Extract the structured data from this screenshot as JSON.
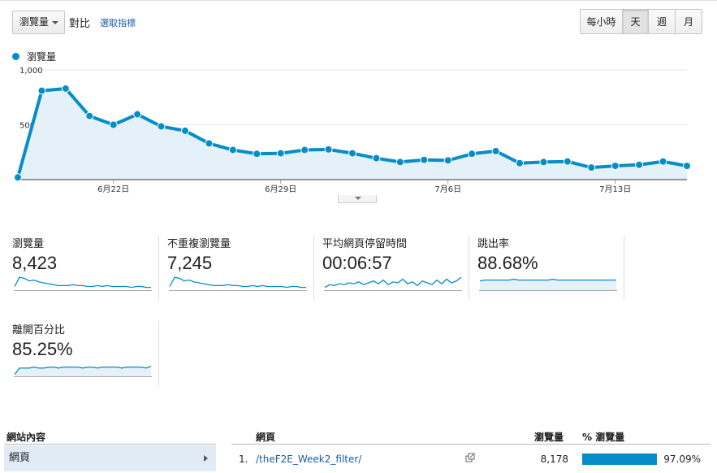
{
  "toolbar": {
    "metric_label": "瀏覽量",
    "compare_label": "對比",
    "select_metric_link": "選取指標",
    "granularity": [
      {
        "label": "每小時",
        "active": false
      },
      {
        "label": "天",
        "active": true
      },
      {
        "label": "週",
        "active": false
      },
      {
        "label": "月",
        "active": false
      }
    ]
  },
  "legend": {
    "label": "瀏覽量",
    "color": "#058dc7"
  },
  "chart_data": {
    "type": "area",
    "series": [
      {
        "name": "瀏覽量",
        "color": "#058dc7",
        "values": [
          20,
          810,
          830,
          580,
          500,
          595,
          485,
          445,
          330,
          270,
          235,
          240,
          270,
          275,
          240,
          195,
          160,
          180,
          175,
          235,
          260,
          150,
          160,
          165,
          110,
          125,
          135,
          165,
          125
        ]
      }
    ],
    "x_tick_labels": [
      "6月22日",
      "6月29日",
      "7月6日",
      "7月13日"
    ],
    "x_tick_indices": [
      4,
      11,
      18,
      25
    ],
    "y_tick_labels": [
      "1,000",
      "500"
    ],
    "y_tick_values": [
      1000,
      500
    ],
    "ylim": [
      0,
      1000
    ],
    "grid": true
  },
  "scorecards": [
    {
      "title": "瀏覽量",
      "value": "8,423",
      "spark": [
        4,
        14,
        13,
        10,
        11,
        9,
        8,
        7,
        6,
        5,
        5,
        5,
        6,
        5,
        5,
        4,
        4,
        5,
        4,
        5,
        4,
        4,
        4,
        4,
        3,
        4,
        4,
        3,
        3
      ],
      "fill": false
    },
    {
      "title": "不重複瀏覽量",
      "value": "7,245",
      "spark": [
        4,
        14,
        13,
        10,
        11,
        9,
        8,
        7,
        6,
        5,
        5,
        5,
        6,
        5,
        5,
        4,
        4,
        5,
        4,
        5,
        4,
        4,
        4,
        4,
        3,
        4,
        4,
        3,
        3
      ],
      "fill": false
    },
    {
      "title": "平均網頁停留時間",
      "value": "00:06:57",
      "spark": [
        3,
        6,
        5,
        7,
        6,
        8,
        7,
        9,
        6,
        8,
        10,
        7,
        11,
        6,
        9,
        8,
        12,
        7,
        9,
        5,
        10,
        8,
        6,
        11,
        7,
        12,
        8,
        10,
        14
      ],
      "fill": false
    },
    {
      "title": "跳出率",
      "value": "88.68%",
      "spark": [
        10,
        11,
        11,
        11,
        11,
        11,
        11,
        12,
        11,
        11,
        11,
        11,
        11,
        11,
        11,
        12,
        11,
        11,
        11,
        11,
        11,
        11,
        11,
        11,
        11,
        11,
        11,
        11,
        11
      ],
      "fill": true
    },
    {
      "title": "離開百分比",
      "value": "85.25%",
      "spark": [
        2,
        9,
        9,
        9,
        10,
        9,
        9,
        10,
        10,
        9,
        10,
        10,
        10,
        10,
        9,
        10,
        10,
        9,
        10,
        10,
        10,
        10,
        9,
        10,
        10,
        10,
        10,
        9,
        11
      ],
      "fill": true
    }
  ],
  "side_panel": {
    "header": "網站內容",
    "item": "網頁"
  },
  "table": {
    "headers": {
      "page": "網頁",
      "views": "瀏覽量",
      "pct": "% 瀏覽量"
    },
    "rows": [
      {
        "index": "1.",
        "page": "/theF2E_Week2_filter/",
        "views": "8,178",
        "pct": "97.09%",
        "pct_value": 97.09
      }
    ]
  }
}
